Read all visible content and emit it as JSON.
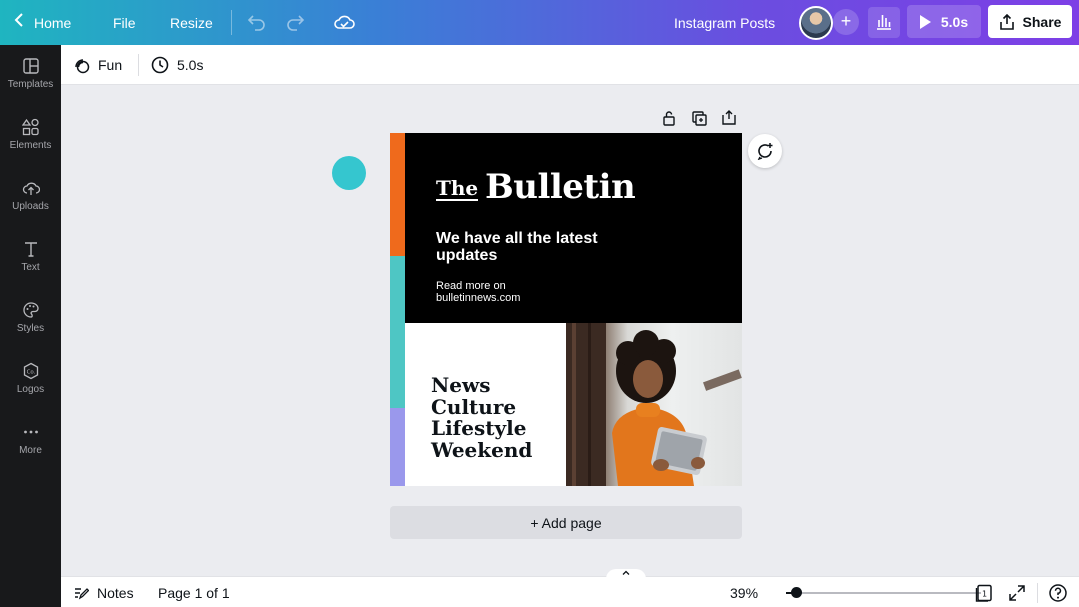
{
  "topbar": {
    "home_label": "Home",
    "file_label": "File",
    "resize_label": "Resize",
    "title": "Instagram Posts",
    "play_label": "5.0s",
    "share_label": "Share",
    "icons": {
      "back": "chevron-left-icon",
      "undo": "undo-icon",
      "redo": "redo-icon",
      "save": "cloud-check-icon",
      "add": "plus-icon",
      "analytics": "bar-chart-icon",
      "play": "play-icon",
      "share": "share-icon"
    }
  },
  "sidebar": {
    "items": [
      {
        "label": "Templates",
        "icon": "templates-icon"
      },
      {
        "label": "Elements",
        "icon": "elements-icon"
      },
      {
        "label": "Uploads",
        "icon": "upload-cloud-icon"
      },
      {
        "label": "Text",
        "icon": "text-icon"
      },
      {
        "label": "Styles",
        "icon": "palette-icon"
      },
      {
        "label": "Logos",
        "icon": "logo-icon"
      },
      {
        "label": "More",
        "icon": "more-icon"
      }
    ]
  },
  "subbar": {
    "animation_label": "Fun",
    "duration_label": "5.0s"
  },
  "design": {
    "the": "The",
    "brand": "Bulletin",
    "headline_line1": "We have all the latest",
    "headline_line2": "updates",
    "read_line1": "Read more on",
    "read_line2": "bulletinnews.com",
    "topics": [
      "News",
      "Culture",
      "Lifestyle",
      "Weekend"
    ],
    "colors": {
      "orange": "#ef6a1c",
      "teal": "#4ec6c4",
      "lavender": "#9a98ec",
      "black": "#000000"
    }
  },
  "canvas": {
    "add_page_label": "+ Add page"
  },
  "bottombar": {
    "notes_label": "Notes",
    "page_label": "Page 1 of 1",
    "zoom_label": "39%",
    "zoom_level": 0.05
  }
}
